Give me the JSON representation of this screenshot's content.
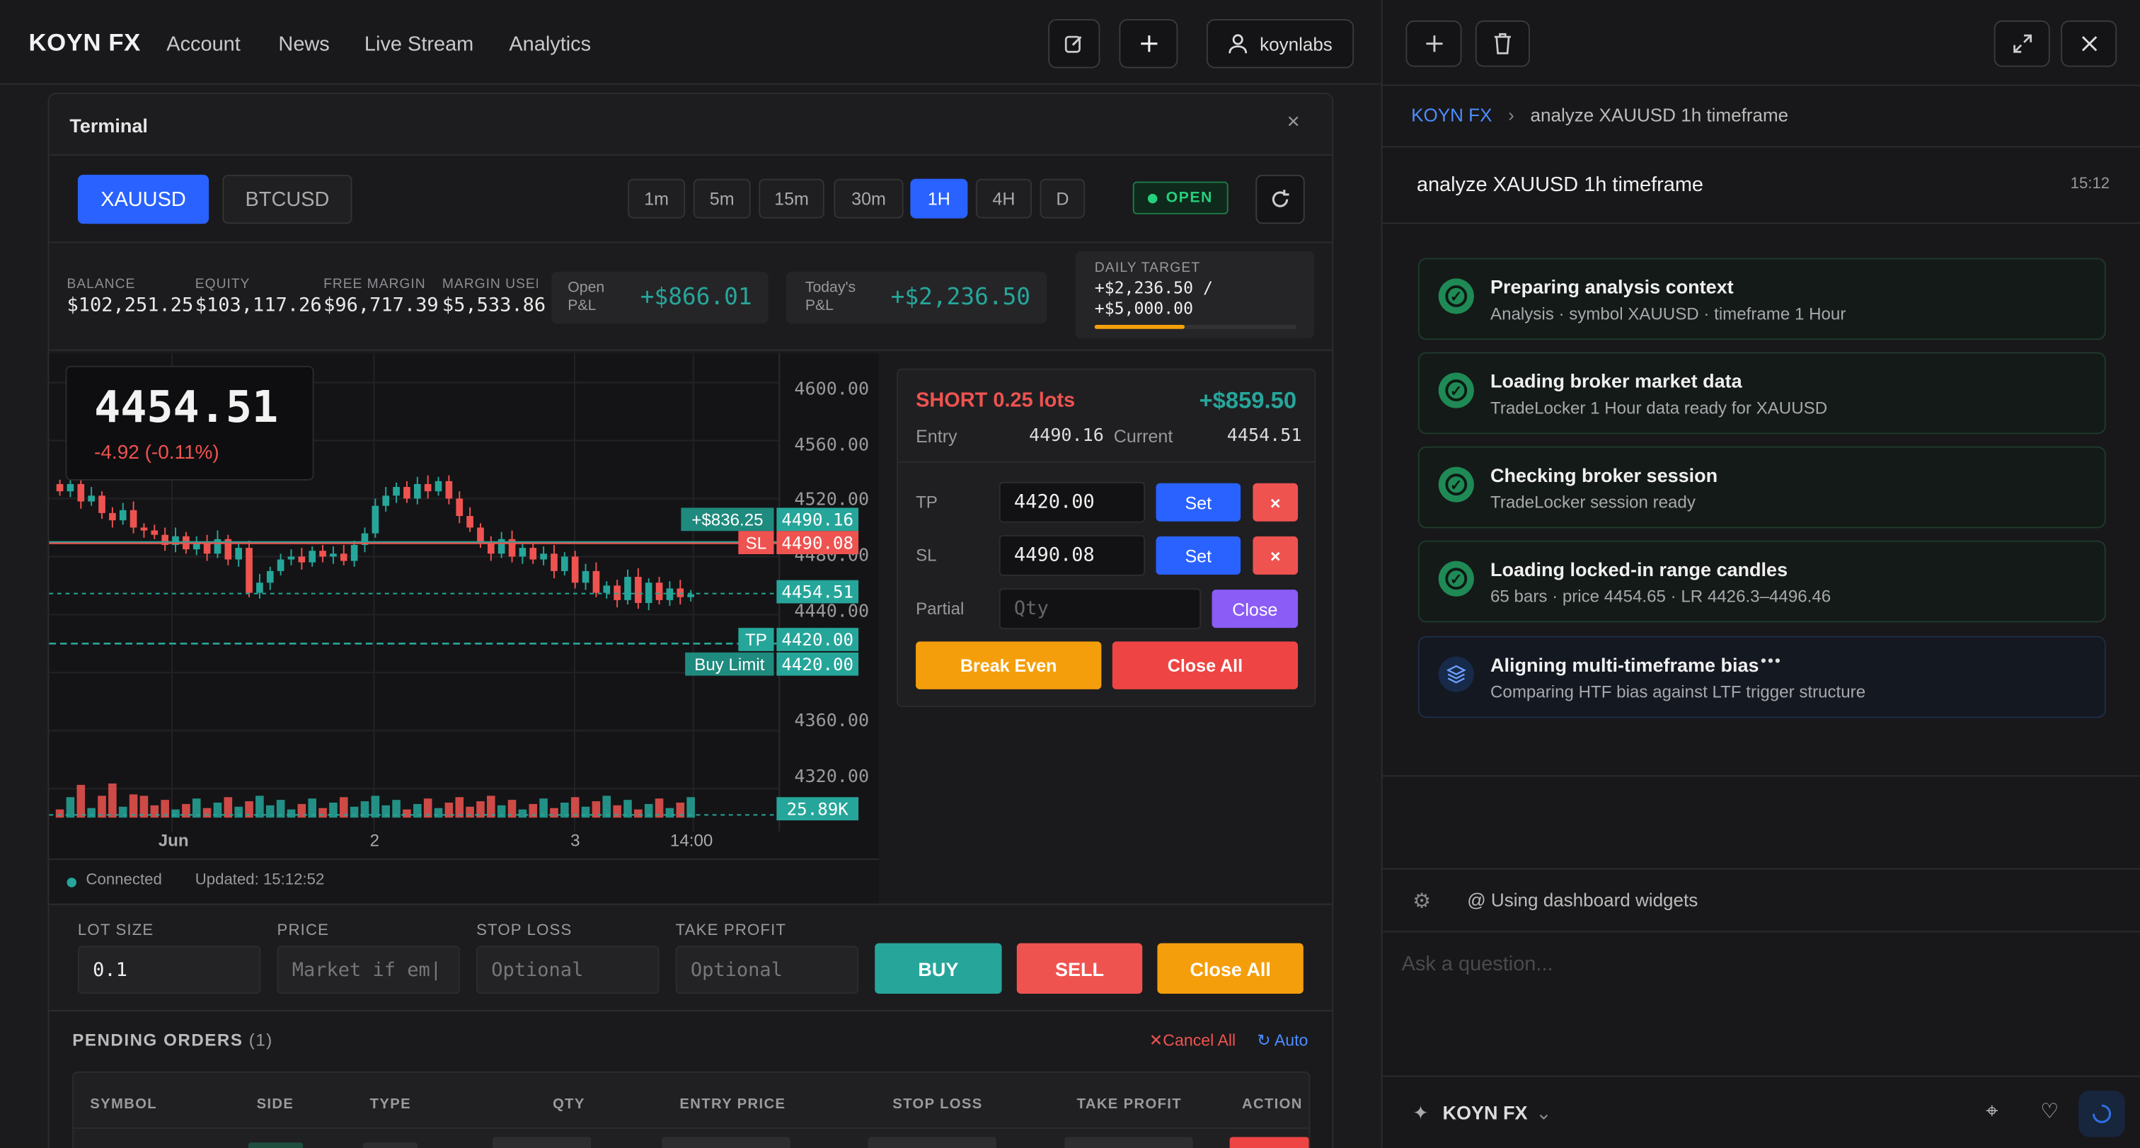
{
  "topbar": {
    "logo": "KOYN FX",
    "nav": [
      "Account",
      "News",
      "Live Stream",
      "Analytics"
    ],
    "user": "koynlabs"
  },
  "terminal": {
    "title": "Terminal",
    "symbols": [
      "XAUUSD",
      "BTCUSD"
    ],
    "timeframes": [
      "1m",
      "5m",
      "15m",
      "30m",
      "1H",
      "4H",
      "D"
    ],
    "active_tf": "1H",
    "status": "OPEN"
  },
  "stats": {
    "balance_label": "BALANCE",
    "balance": "$102,251.25",
    "equity_label": "EQUITY",
    "equity": "$103,117.26",
    "free_margin_label": "FREE MARGIN",
    "free_margin": "$96,717.39",
    "margin_used_label": "MARGIN USEI",
    "margin_used": "$5,533.86",
    "open_pl_label1": "Open",
    "open_pl_label2": "P&L",
    "open_pl": "+$866.01",
    "today_pl_label1": "Today's",
    "today_pl_label2": "P&L",
    "today_pl": "+$2,236.50",
    "daily_target_label": "DAILY TARGET",
    "daily_target_line1": "+$2,236.50 /",
    "daily_target_line2": "+$5,000.00",
    "daily_target_progress": 0.447
  },
  "chart": {
    "price": "4454.51",
    "change": "-4.92 (-0.11%)",
    "price_levels": [
      "4600.00",
      "4560.00",
      "4520.00",
      "4480.00",
      "4440.00",
      "4360.00",
      "4320.00"
    ],
    "tags": {
      "pl_tag": "+$836.25",
      "pl_price": "4490.16",
      "sl_label": "SL",
      "sl_price": "4490.08",
      "cur_price": "4454.51",
      "tp_label": "TP",
      "tp_price": "4420.00",
      "bl_label": "Buy Limit",
      "bl_price": "4420.00",
      "vol": "25.89K"
    },
    "x_labels": [
      "Jun",
      "2",
      "3",
      "14:00"
    ],
    "connected": "Connected",
    "updated": "Updated: 15:12:52"
  },
  "position": {
    "side": "SHORT 0.25 lots",
    "pnl": "+$859.50",
    "entry_label": "Entry",
    "entry": "4490.16",
    "current_label": "Current",
    "current": "4454.51",
    "tp_label": "TP",
    "tp": "4420.00",
    "sl_label": "SL",
    "sl": "4490.08",
    "set": "Set",
    "partial_label": "Partial",
    "qty_placeholder": "Qty",
    "close": "Close",
    "break_even": "Break Even",
    "close_all": "Close All"
  },
  "order": {
    "lot_label": "LOT SIZE",
    "lot": "0.1",
    "price_label": "PRICE",
    "price_ph": "Market if em|",
    "sl_label": "STOP LOSS",
    "sl_ph": "Optional",
    "tp_label": "TAKE PROFIT",
    "tp_ph": "Optional",
    "buy": "BUY",
    "sell": "SELL",
    "close_all": "Close All"
  },
  "pending": {
    "title": "PENDING ORDERS",
    "count": "(1)",
    "cancel_all": "Cancel All",
    "auto": "Auto",
    "columns": [
      "SYMBOL",
      "SIDE",
      "TYPE",
      "QTY",
      "ENTRY PRICE",
      "STOP LOSS",
      "TAKE PROFIT",
      "ACTION"
    ]
  },
  "assistant": {
    "breadcrumb_root": "KOYN FX",
    "breadcrumb_leaf": "analyze XAUUSD 1h timeframe",
    "query": "analyze XAUUSD 1h timeframe",
    "time": "15:12",
    "steps": [
      {
        "title": "Preparing analysis context",
        "sub": "Analysis · symbol XAUUSD · timeframe 1 Hour"
      },
      {
        "title": "Loading broker market data",
        "sub": "TradeLocker 1 Hour data ready for XAUUSD"
      },
      {
        "title": "Checking broker session",
        "sub": "TradeLocker session ready"
      },
      {
        "title": "Loading locked-in range candles",
        "sub": "65 bars · price 4454.65 · LR 4426.3–4496.46"
      },
      {
        "title": "Aligning multi-timeframe bias",
        "sub": "Comparing HTF bias against LTF trigger structure"
      }
    ],
    "widgets": "Using dashboard widgets",
    "ask_placeholder": "Ask a question...",
    "model": "KOYN FX"
  },
  "colors": {
    "green": "#26a69a",
    "red": "#ef5350",
    "blue": "#2962ff",
    "orange": "#f5a00a"
  }
}
